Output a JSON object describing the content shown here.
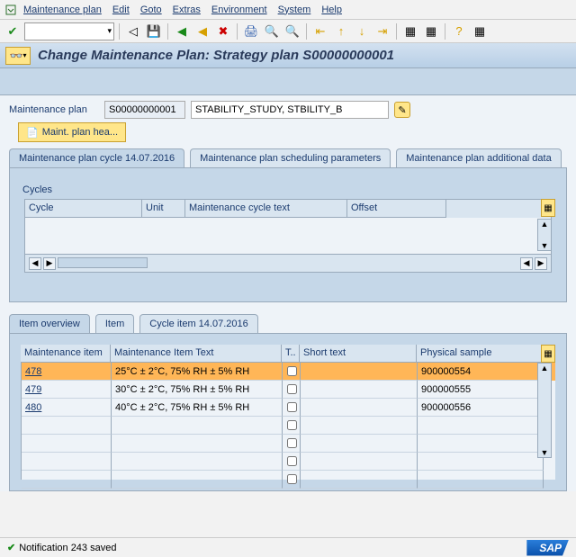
{
  "menu": {
    "items": [
      "Maintenance plan",
      "Edit",
      "Goto",
      "Extras",
      "Environment",
      "System",
      "Help"
    ]
  },
  "title": "Change Maintenance Plan: Strategy plan S00000000001",
  "form": {
    "label": "Maintenance plan",
    "plan_no": "S00000000001",
    "plan_text": "STABILITY_STUDY, STBILITY_B",
    "header_btn": "Maint. plan hea..."
  },
  "tabs_top": [
    "Maintenance plan cycle 14.07.2016",
    "Maintenance plan scheduling parameters",
    "Maintenance plan additional data"
  ],
  "cycles": {
    "group_label": "Cycles",
    "cols": {
      "cycle": "Cycle",
      "unit": "Unit",
      "text": "Maintenance cycle text",
      "offset": "Offset"
    }
  },
  "tabs_items": [
    "Item overview",
    "Item",
    "Cycle item 14.07.2016"
  ],
  "items_table": {
    "cols": {
      "maint_item": "Maintenance item",
      "text": "Maintenance Item Text",
      "t": "T..",
      "short": "Short text",
      "sample": "Physical sample"
    },
    "rows": [
      {
        "item": "478",
        "text": "25°C ± 2°C, 75% RH ± 5% RH",
        "short": "",
        "sample": "900000554",
        "selected": true
      },
      {
        "item": "479",
        "text": "30°C ± 2°C, 75% RH ± 5% RH",
        "short": "",
        "sample": "900000555",
        "selected": false
      },
      {
        "item": "480",
        "text": "40°C ± 2°C, 75% RH ± 5% RH",
        "short": "",
        "sample": "900000556",
        "selected": false
      }
    ]
  },
  "status": "Notification 243 saved"
}
